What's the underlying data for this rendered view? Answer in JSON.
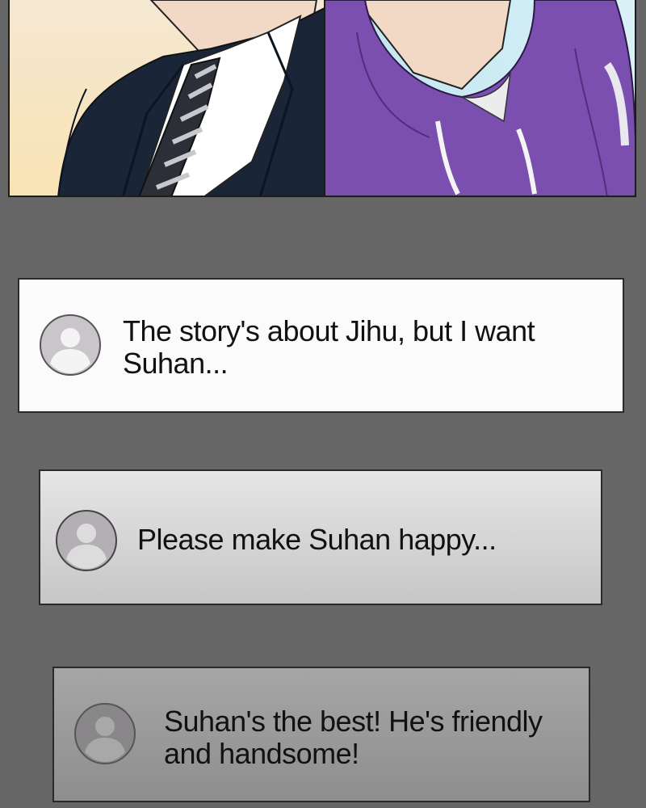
{
  "illustration": {
    "description_icon": "manhwa-panel-icon"
  },
  "comments": [
    {
      "avatar_icon": "default-user-avatar-icon",
      "text": "The story's about Jihu, but I want Suhan..."
    },
    {
      "avatar_icon": "default-user-avatar-icon",
      "text": "Please make Suhan happy..."
    },
    {
      "avatar_icon": "default-user-avatar-icon",
      "text": "Suhan's the best! He's friendly and handsome!"
    }
  ],
  "colors": {
    "background": "#666666",
    "suit": "#1b2538",
    "hoodie": "#7a4fb0"
  }
}
